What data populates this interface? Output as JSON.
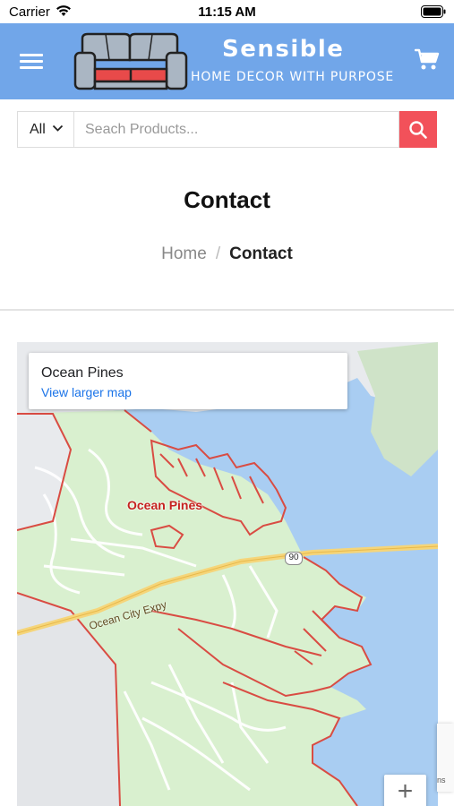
{
  "status_bar": {
    "carrier": "Carrier",
    "time": "11:15 AM",
    "wifi_icon": "wifi-icon",
    "battery_icon": "battery-icon"
  },
  "header": {
    "brand_name": "Sensible",
    "tagline": "HOME DECOR WITH PURPOSE",
    "menu_icon": "hamburger-menu-icon",
    "logo_icon": "sofa-logo",
    "cart_icon": "shopping-cart-icon",
    "background_color": "#71a6e9"
  },
  "search": {
    "category_value": "All",
    "placeholder": "Seach Products...",
    "value": "",
    "button_icon": "search-icon",
    "button_color": "#f2515a"
  },
  "page": {
    "title": "Contact",
    "breadcrumb": {
      "home": "Home",
      "separator": "/",
      "current": "Contact"
    }
  },
  "map": {
    "place_title": "Ocean Pines",
    "view_larger_link": "View larger map",
    "place_label": "Ocean Pines",
    "road_label": "Ocean City Expy",
    "route_shield": "90",
    "zoom_in_label": "+",
    "recaptcha_text": "ns"
  }
}
